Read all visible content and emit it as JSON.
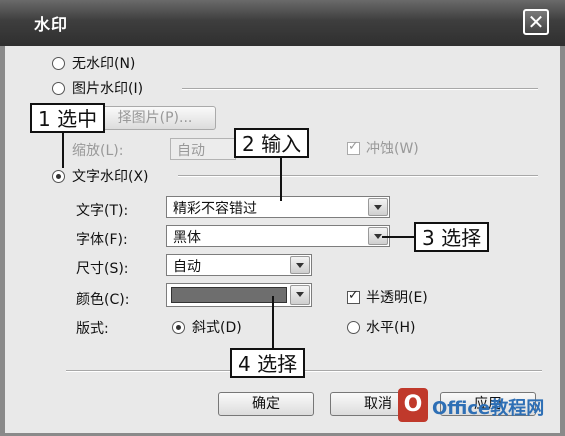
{
  "window": {
    "title": "水印",
    "close_glyph": "✕"
  },
  "options": {
    "no_watermark": "无水印(N)",
    "picture_watermark": "图片水印(I)",
    "select_picture_button": "择图片(P)...",
    "scale_label": "缩放(L):",
    "scale_value": "自动",
    "washout_label": "冲蚀(W)",
    "text_watermark": "文字水印(X)"
  },
  "text_settings": {
    "text_label": "文字(T):",
    "text_value": "精彩不容错过",
    "font_label": "字体(F):",
    "font_value": "黑体",
    "size_label": "尺寸(S):",
    "size_value": "自动",
    "color_label": "颜色(C):",
    "semitransparent_label": "半透明(E)",
    "layout_label": "版式:",
    "diagonal_label": "斜式(D)",
    "horizontal_label": "水平(H)"
  },
  "buttons": {
    "ok": "确定",
    "cancel": "取消",
    "apply": "应用"
  },
  "annotations": {
    "step1": "1 选中",
    "step2": "2 输入",
    "step3": "3 选择",
    "step4": "4 选择"
  },
  "watermark_logo": "Office教程网",
  "colors": {
    "selected_color_swatch": "#6e6e6e"
  }
}
